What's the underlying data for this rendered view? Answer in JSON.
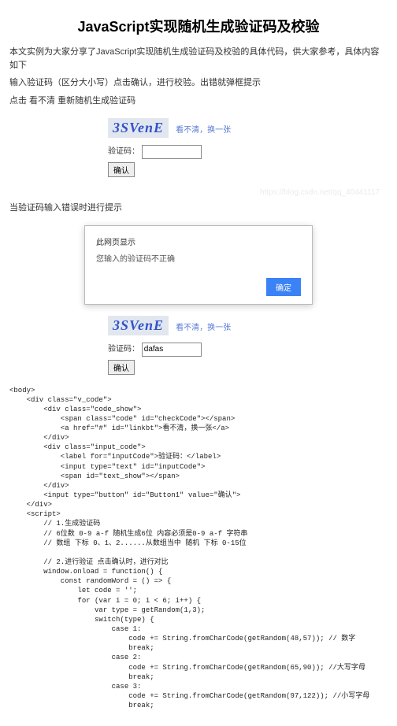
{
  "title": "JavaScript实现随机生成验证码及校验",
  "intro": "本文实例为大家分享了JavaScript实现随机生成验证码及校验的具体代码，供大家参考，具体内容如下",
  "step1": "输入验证码（区分大小写）点击确认，进行校验。出错就弹框提示",
  "step2": "点击 看不清 重新随机生成验证码",
  "captcha_text": "3SVenE",
  "refresh_label": "看不清，换一张",
  "label_code": "验证码：",
  "btn_confirm": "确认",
  "watermark": "https://blog.csdn.net/qq_40441117",
  "section_error": "当验证码输入错误时进行提示",
  "dialog": {
    "title": "此网页显示",
    "msg": "您输入的验证码不正确",
    "ok": "确定"
  },
  "typed_value": "dafas",
  "code_block": "<body>\n    <div class=\"v_code\">\n        <div class=\"code_show\">\n            <span class=\"code\" id=\"checkCode\"></span>\n            <a href=\"#\" id=\"linkbt\">看不清，换一张</a>\n        </div>\n        <div class=\"input_code\">\n            <label for=\"inputCode\">验证码：</label>\n            <input type=\"text\" id=\"inputCode\">\n            <span id=\"text_show\"></span>\n        </div>\n        <input type=\"button\" id=\"Button1\" value=\"确认\">\n    </div>\n    <script>\n        // 1.生成验证码\n        // 6位数 0-9 a-f 随机生成6位 内容必须是0-9 a-f 字符串\n        // 数组 下标 0、1、2......从数组当中 随机 下标 0-15位\n\n        // 2.进行验证 点击确认时，进行对比\n        window.onload = function() {\n            const randomWord = () => {\n                let code = '';\n                for (var i = 0; i < 6; i++) {\n                    var type = getRandom(1,3);\n                    switch(type) {\n                        case 1:\n                            code += String.fromCharCode(getRandom(48,57)); // 数字\n                            break;\n                        case 2:\n                            code += String.fromCharCode(getRandom(65,90)); //大写字母\n                            break;\n                        case 3:\n                            code += String.fromCharCode(getRandom(97,122)); //小写字母\n                            break;"
}
